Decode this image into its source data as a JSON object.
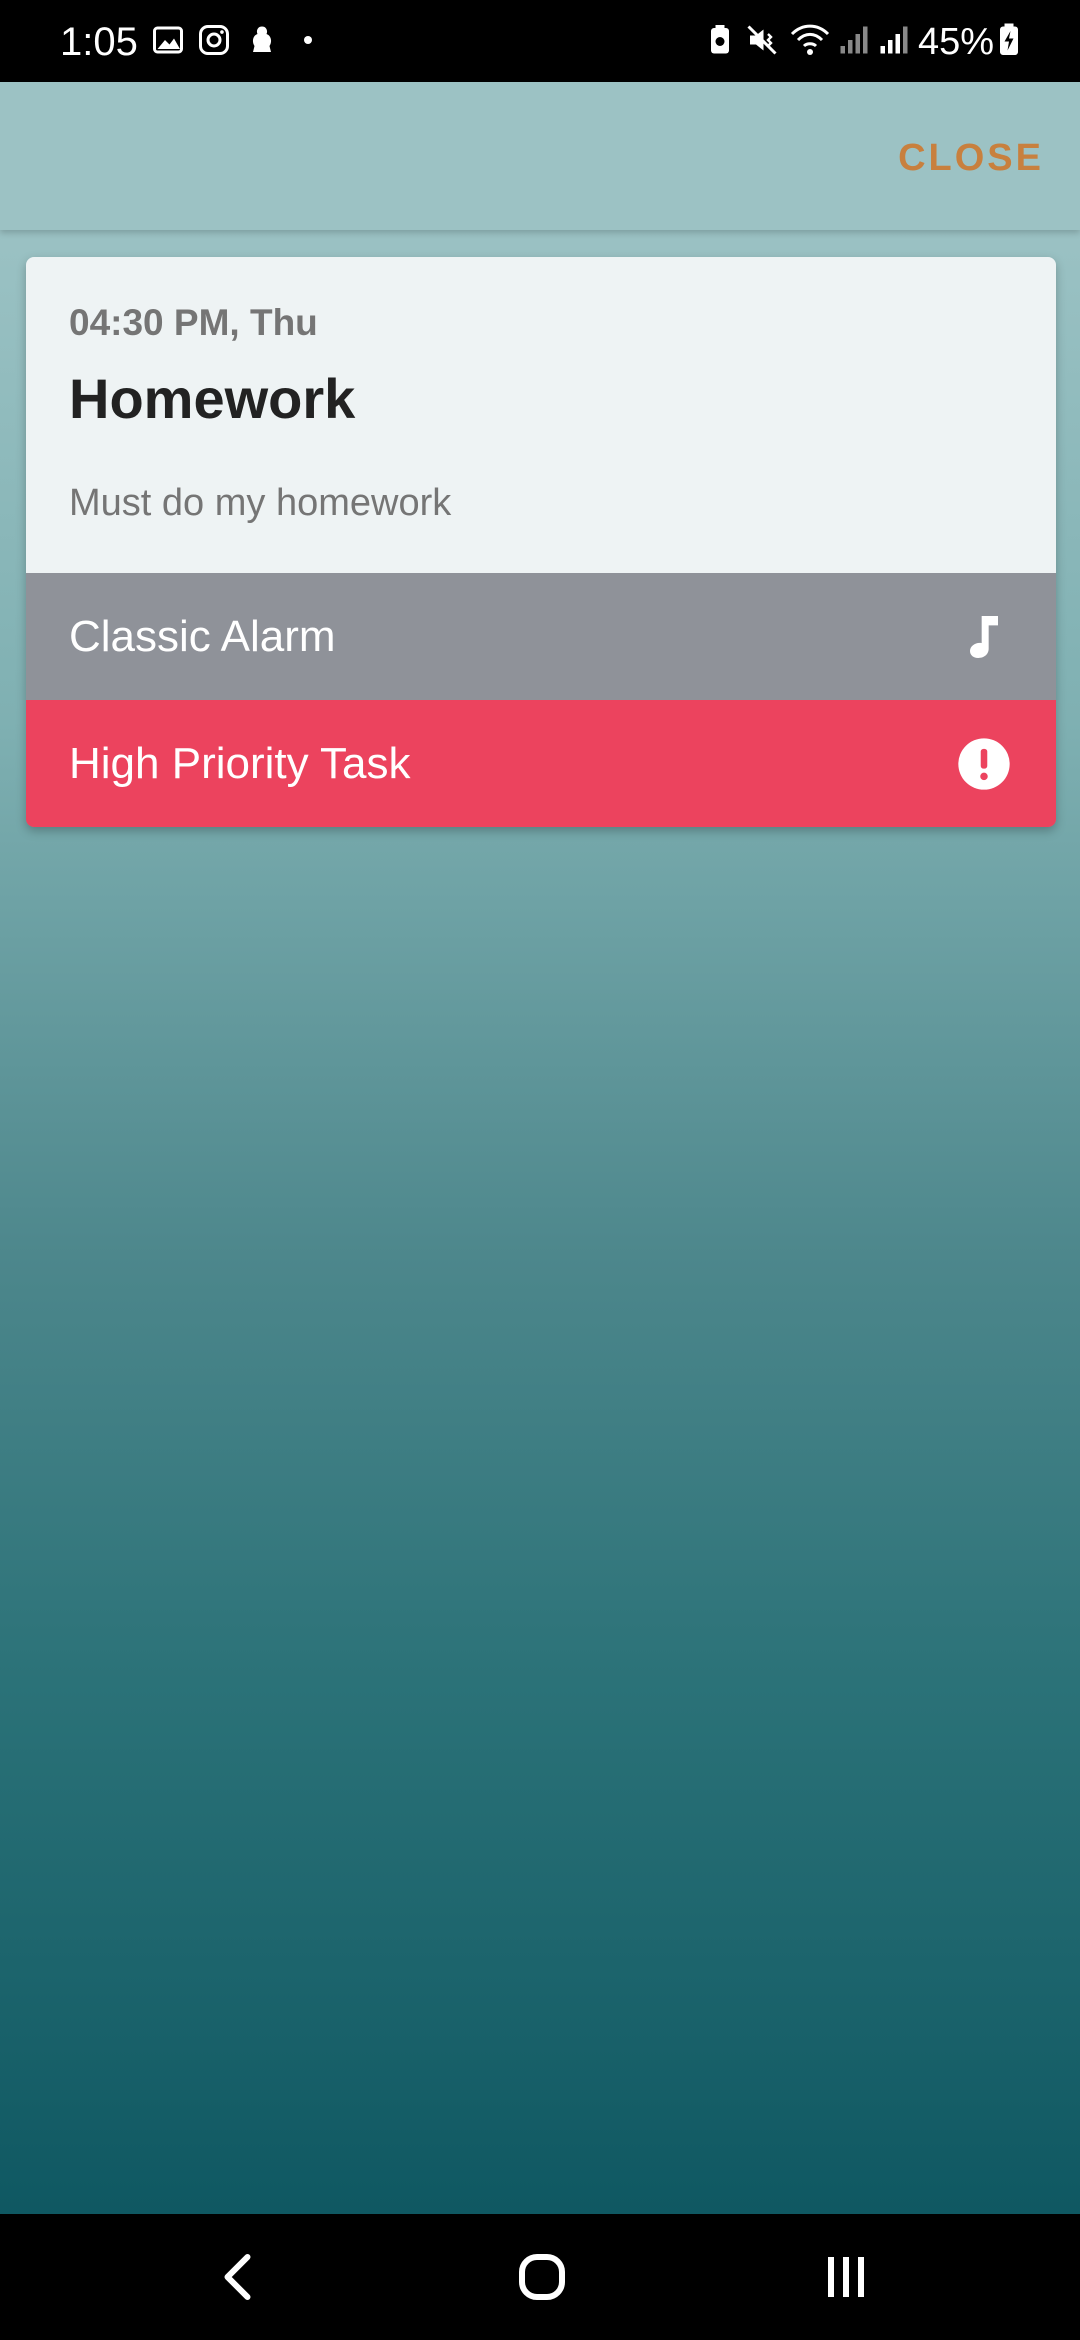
{
  "status_bar": {
    "time": "1:05",
    "battery": "45%",
    "icons": [
      "image-icon",
      "instagram-icon",
      "app-notification-icon",
      "dot-icon",
      "battery-saver-icon",
      "mute-vibrate-icon",
      "wifi-icon",
      "signal-icon",
      "signal-icon-2",
      "battery-charging-icon"
    ]
  },
  "app_bar": {
    "close_label": "CLOSE",
    "close_color": "#c8803e"
  },
  "task": {
    "datetime": "04:30 PM, Thu",
    "title": "Homework",
    "description": "Must do my homework",
    "sound_label": "Classic Alarm",
    "sound_icon": "music-note-icon",
    "priority_label": "High Priority Task",
    "priority_icon": "alert-circle-icon",
    "priority_color": "#ec435e",
    "sound_row_color": "#8f9299"
  },
  "nav_bar": {
    "buttons": [
      "back-icon",
      "home-icon",
      "recents-icon"
    ]
  }
}
